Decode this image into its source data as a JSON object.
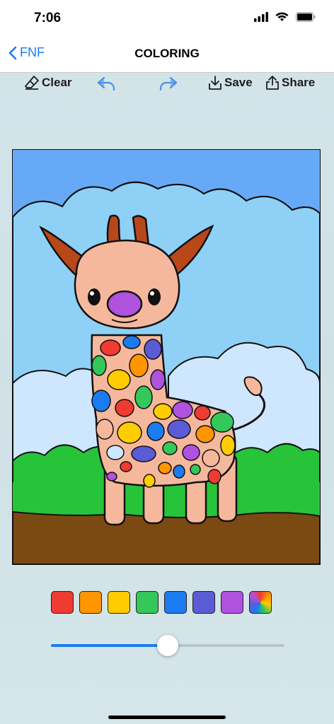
{
  "status": {
    "time": "7:06"
  },
  "nav": {
    "back_label": "FNF",
    "title": "COLORING"
  },
  "toolbar": {
    "clear_label": "Clear",
    "save_label": "Save",
    "share_label": "Share",
    "undo_icon": "undo-arrow",
    "redo_icon": "redo-arrow"
  },
  "palette": {
    "colors": [
      "#ef3b32",
      "#ff9500",
      "#ffcc00",
      "#34c759",
      "#1a7cf0",
      "#5b5bd6",
      "#af52de",
      "rainbow"
    ]
  },
  "brush_size": {
    "value": 0.5
  },
  "colors": {
    "accent": "#1a7cf0",
    "nav_bg": "#ffffff",
    "page_bg": "#d4e5ea"
  }
}
